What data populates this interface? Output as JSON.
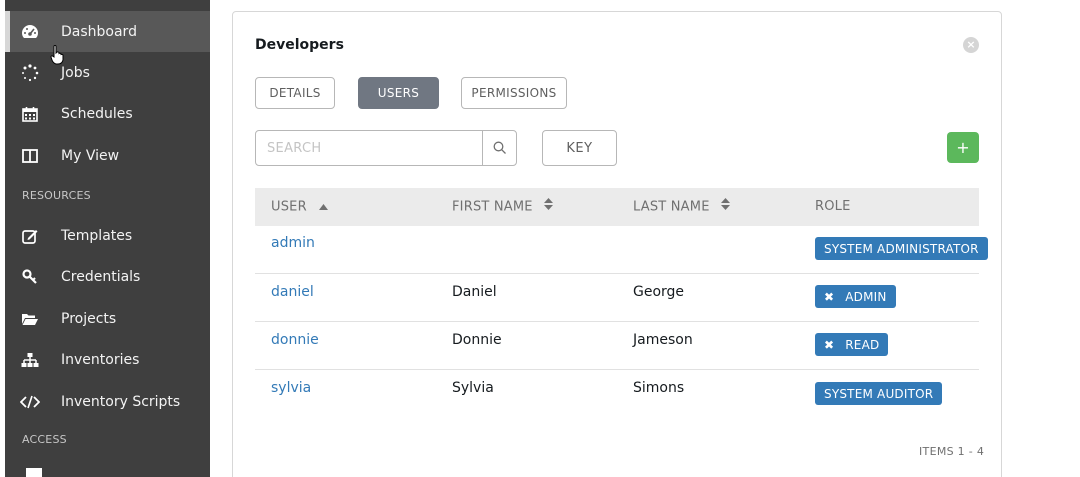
{
  "sidebar": {
    "items": [
      {
        "id": "dashboard",
        "label": "Dashboard",
        "icon": "tachometer-icon",
        "active": true
      },
      {
        "id": "jobs",
        "label": "Jobs",
        "icon": "spinner-icon",
        "active": false
      },
      {
        "id": "schedules",
        "label": "Schedules",
        "icon": "calendar-icon",
        "active": false
      },
      {
        "id": "my-view",
        "label": "My View",
        "icon": "columns-icon",
        "active": false
      }
    ],
    "resources_header": "RESOURCES",
    "resources": [
      {
        "id": "templates",
        "label": "Templates",
        "icon": "edit-icon"
      },
      {
        "id": "credentials",
        "label": "Credentials",
        "icon": "key-icon"
      },
      {
        "id": "projects",
        "label": "Projects",
        "icon": "folder-open-icon"
      },
      {
        "id": "inventories",
        "label": "Inventories",
        "icon": "sitemap-icon"
      },
      {
        "id": "inventory-scripts",
        "label": "Inventory Scripts",
        "icon": "code-icon"
      }
    ],
    "access_header": "ACCESS"
  },
  "card": {
    "title": "Developers",
    "tabs": [
      {
        "id": "details",
        "label": "DETAILS",
        "active": false
      },
      {
        "id": "users",
        "label": "USERS",
        "active": true
      },
      {
        "id": "permissions",
        "label": "PERMISSIONS",
        "active": false
      }
    ],
    "search": {
      "placeholder": "SEARCH",
      "value": ""
    },
    "key_label": "KEY",
    "add_label": "+",
    "close_label": "×"
  },
  "table": {
    "columns": [
      {
        "id": "user",
        "label": "USER",
        "sort": "asc"
      },
      {
        "id": "first_name",
        "label": "FIRST NAME",
        "sort": "both"
      },
      {
        "id": "last_name",
        "label": "LAST NAME",
        "sort": "both"
      },
      {
        "id": "role",
        "label": "ROLE",
        "sort": "none"
      }
    ],
    "rows": [
      {
        "user": "admin",
        "first_name": "",
        "last_name": "",
        "role": "SYSTEM ADMINISTRATOR",
        "removable": false
      },
      {
        "user": "daniel",
        "first_name": "Daniel",
        "last_name": "George",
        "role": "ADMIN",
        "removable": true
      },
      {
        "user": "donnie",
        "first_name": "Donnie",
        "last_name": "Jameson",
        "role": "READ",
        "removable": true
      },
      {
        "user": "sylvia",
        "first_name": "Sylvia",
        "last_name": "Simons",
        "role": "SYSTEM AUDITOR",
        "removable": false
      }
    ],
    "items_label": "ITEMS  1 - 4"
  },
  "colors": {
    "sidebar_bg": "#3f3f3f",
    "sidebar_active_bg": "#585858",
    "tab_active_bg": "#707782",
    "link": "#337ab7",
    "badge": "#337ab7",
    "add_button": "#5cb85c",
    "table_header_bg": "#ebebeb"
  }
}
